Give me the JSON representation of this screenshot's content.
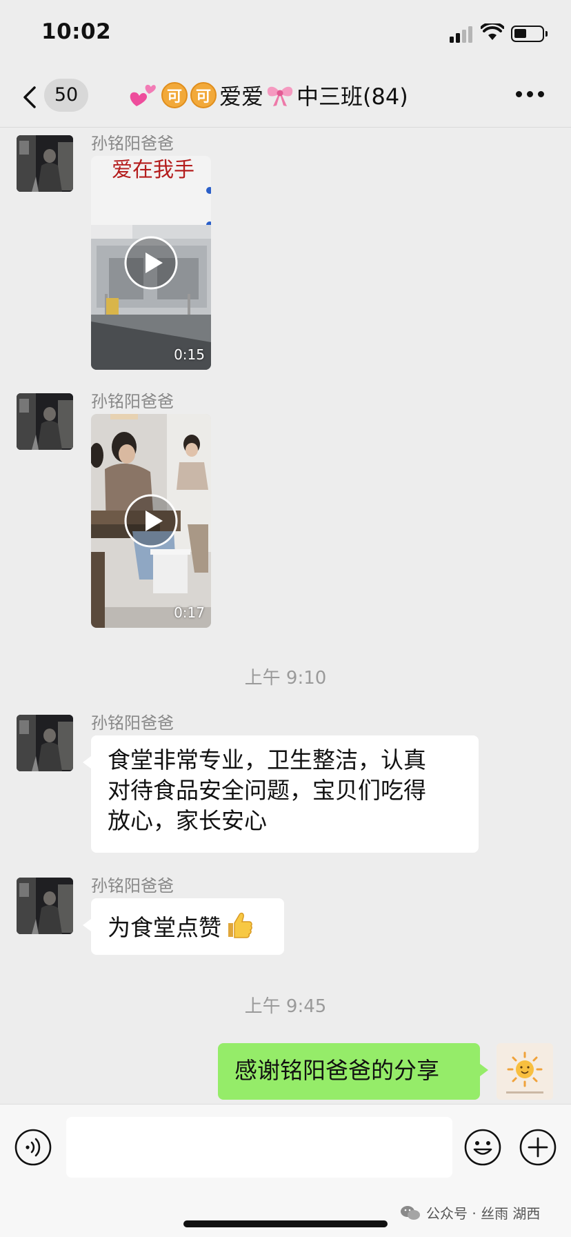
{
  "status_bar": {
    "time": "10:02"
  },
  "nav": {
    "unread_count": "50",
    "title_coin_1": "可",
    "title_coin_2": "可",
    "title_text_1": "爱爱",
    "title_text_2": "中三班(84)"
  },
  "messages": [
    {
      "type": "video",
      "sender": "孙铭阳爸爸",
      "duration": "0:15"
    },
    {
      "type": "video",
      "sender": "孙铭阳爸爸",
      "duration": "0:17"
    },
    {
      "type": "timestamp",
      "text": "上午 9:10"
    },
    {
      "type": "text",
      "sender": "孙铭阳爸爸",
      "lines": [
        "食堂非常专业，卫生整洁，认真",
        "对待食品安全问题，宝贝们吃得",
        "放心，家长安心"
      ]
    },
    {
      "type": "text",
      "sender": "孙铭阳爸爸",
      "text": "为食堂点赞"
    },
    {
      "type": "timestamp",
      "text": "上午 9:45"
    },
    {
      "type": "text",
      "sender": "self",
      "text": "感谢铭阳爸爸的分享"
    }
  ],
  "watermark": "公众号 · 丝雨 湖西",
  "icons": {
    "back": "chevron-left-icon",
    "more": "more-icon",
    "voice": "voice-icon",
    "emoji": "emoji-icon",
    "add": "plus-icon",
    "play": "play-icon",
    "thumbs_up": "thumbs-up-icon"
  },
  "colors": {
    "background": "#ededed",
    "my_bubble": "#95ec69",
    "their_bubble": "#ffffff",
    "sender_name": "#888888"
  }
}
